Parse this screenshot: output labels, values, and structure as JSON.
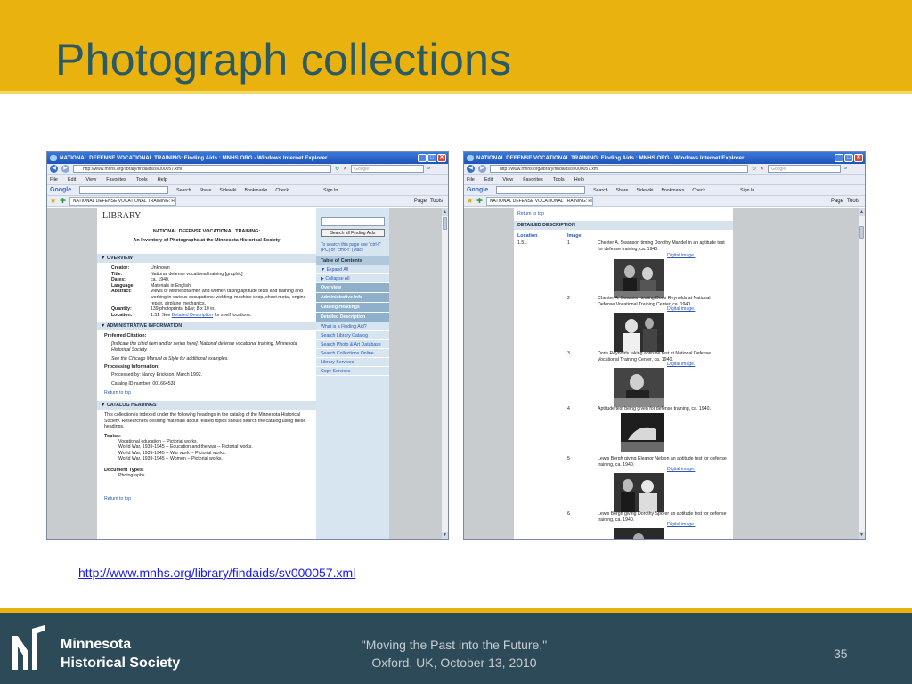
{
  "slide": {
    "title": "Photograph collections",
    "url": "http://www.mnhs.org/library/findaids/sv000057.xml",
    "footer_quote_line1": "\"Moving the Past into the Future,\"",
    "footer_quote_line2": "Oxford, UK, October 13, 2010",
    "page_number": "35",
    "logo_line1": "Minnesota",
    "logo_line2": "Historical Society",
    "colors": {
      "header": "#e9b20f",
      "title": "#2a5a66",
      "footer": "#2c4a57",
      "link": "#1a1aee"
    }
  },
  "browser": {
    "window_title": "NATIONAL DEFENSE VOCATIONAL TRAINING: Finding Aids : MNHS.ORG - Windows Internet Explorer",
    "address": "http://www.mnhs.org/library/findaids/sv000057.xml",
    "search_placeholder": "Google",
    "menu": [
      "File",
      "Edit",
      "View",
      "Favorites",
      "Tools",
      "Help"
    ],
    "google_label": "Google",
    "google_tools": [
      "Search",
      "Share",
      "Sidewiki",
      "Bookmarks",
      "Check",
      "Sign In"
    ],
    "tab_label": "NATIONAL DEFENSE VOCATIONAL TRAINING: Finding...",
    "tab_tools": [
      "Page",
      "Tools"
    ]
  },
  "left_page": {
    "library": "LIBRARY",
    "title": "NATIONAL DEFENSE VOCATIONAL TRAINING:",
    "subtitle": "An Inventory of Photographs at the Minnesota Historical Society",
    "overview_head": "▼ OVERVIEW",
    "overview": [
      {
        "k": "Creator:",
        "v": "Unknown"
      },
      {
        "k": "Title:",
        "v": "National defense vocational training [graphic]"
      },
      {
        "k": "Dates:",
        "v": "ca. 1940."
      },
      {
        "k": "Language:",
        "v": "Materials in English."
      },
      {
        "k": "Abstract:",
        "v": "Views of Minnesota men and women taking aptitude tests and training and working in various occupations: welding, machine shop, sheet metal, engine repair, airplane mechanics."
      },
      {
        "k": "Quantity:",
        "v": "139 photoprints: b&w; 8 x 10 in."
      }
    ],
    "location_k": "Location:",
    "location_pre": "1.51: See ",
    "location_link": "Detailed Description",
    "location_post": " for shelf locations.",
    "admin_head": "▼ ADMINISTRATIVE INFORMATION",
    "pref_cite": "Preferred Citation:",
    "pref_cite_text": "[Indicate the cited item and/or series here]. National defense vocational training. Minnesota Historical Society.",
    "chicago": "See the Chicago Manual of Style for additional examples.",
    "processing": "Processing Information:",
    "processed_by": "Processed by: Nancy Erickson, March 1992.",
    "catalog_id": "Catalog ID number: 001664538",
    "return_top": "Return to top",
    "catalog_head": "▼ CATALOG HEADINGS",
    "catalog_para": "This collection is indexed under the following headings in the catalog of the Minnesota Historical Society. Researchers desiring materials about related topics should search the catalog using these headings.",
    "topics_head": "Topics:",
    "topics": [
      "Vocational education -- Pictorial works.",
      "World War, 1939-1945 -- Education and the war -- Pictorial works.",
      "World War, 1939-1945 -- War work -- Pictorial works.",
      "World War, 1939-1945 -- Women -- Pictorial works."
    ],
    "doctypes_head": "Document Types:",
    "doctypes": [
      "Photographs."
    ],
    "return_top2": "Return to top"
  },
  "sidebar": {
    "search_button": "Search all Finding Aids",
    "search_hint": "To search this page use \"ctrl-f\" (PC) or \"cmd-f\" (Mac)",
    "toc_head": "Table of Contents",
    "expand": "▼ Expand All",
    "collapse": "▶ Collapse All",
    "dark_items": [
      "Overview",
      "Administrative Info",
      "Catalog Headings",
      "Detailed Description"
    ],
    "link_items": [
      "What is a Finding Aid?",
      "Search Library Catalog",
      "Search Photo & Art Database",
      "Search Collections Online",
      "Library Services",
      "Copy Services"
    ]
  },
  "right_page": {
    "return_top": "Return to top",
    "detail_head": "DETAILED DESCRIPTION",
    "col_location": "Location",
    "col_image": "Image",
    "digital": "Digital image.",
    "items": [
      {
        "loc": "1.51.",
        "num": "1",
        "desc": "Chester A. Swanson timing Dorothy Mandel in an aptitude test for defense training, ca. 1940."
      },
      {
        "loc": "",
        "num": "2",
        "desc": "Chester A. Swanson testing Doris Reynolds at National Defense Vocational Training Center, ca. 1940."
      },
      {
        "loc": "",
        "num": "3",
        "desc": "Doris Reynolds taking aptitude test at National Defense Vocational Training Center, ca. 1940."
      },
      {
        "loc": "",
        "num": "4",
        "desc": "Aptitude test being given for defense training, ca. 1940."
      },
      {
        "loc": "",
        "num": "5",
        "desc": "Lewis Bergh giving Eleanor Nelson an aptitude test for defense training, ca. 1940."
      },
      {
        "loc": "",
        "num": "6",
        "desc": "Lewis Bergh giving Dorothy Sporer an aptitude test for defense training, ca. 1940."
      }
    ]
  }
}
